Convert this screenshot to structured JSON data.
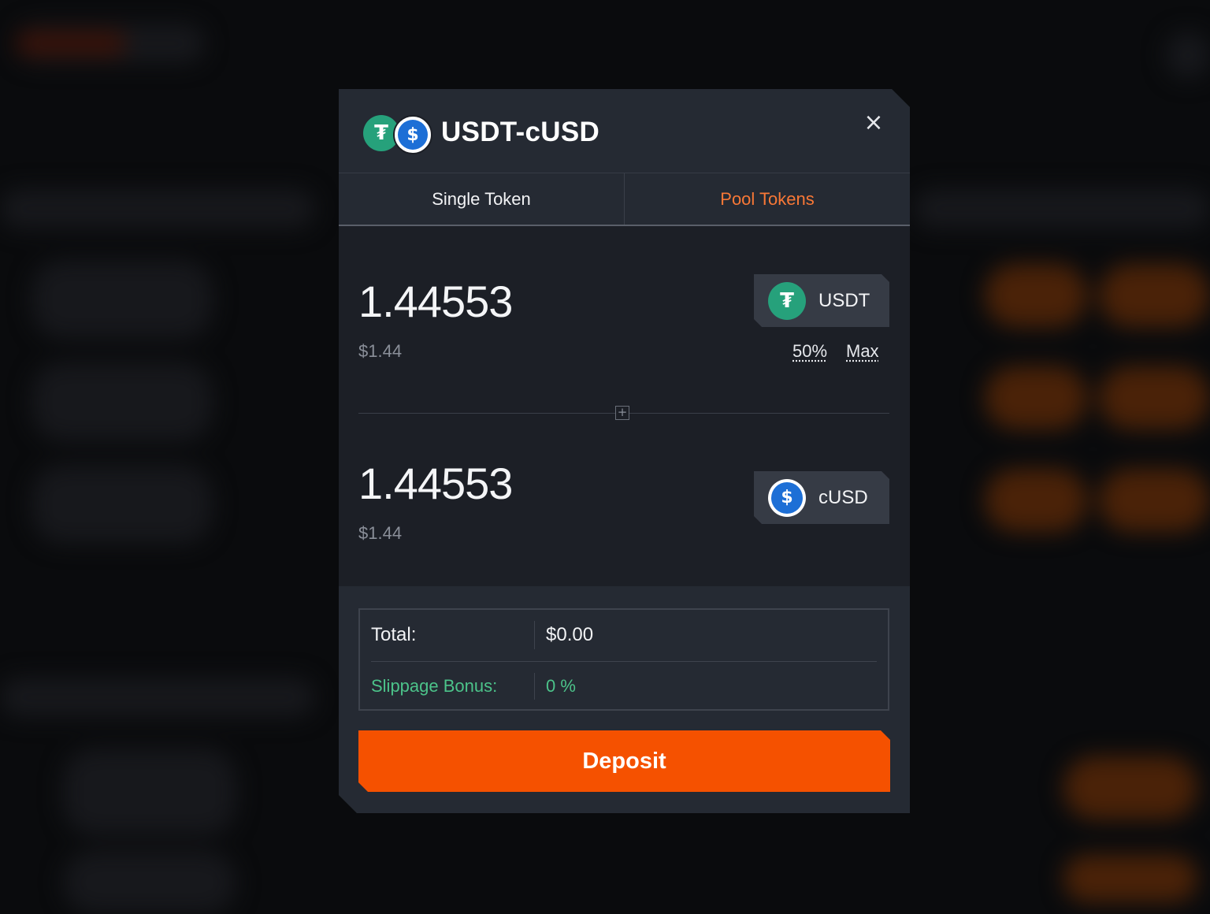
{
  "modal": {
    "title": "USDT-cUSD",
    "close_label": "×",
    "pair_icons": [
      "tether-icon",
      "cusd-icon"
    ]
  },
  "tabs": [
    {
      "label": "Single Token",
      "active": false
    },
    {
      "label": "Pool Tokens",
      "active": true
    }
  ],
  "inputs": [
    {
      "amount": "1.44553",
      "usd_value": "$1.44",
      "token": "USDT",
      "icon": "tether-icon"
    },
    {
      "amount": "1.44553",
      "usd_value": "$1.44",
      "token": "cUSD",
      "icon": "cusd-icon"
    }
  ],
  "quick_amounts": [
    "50%",
    "Max"
  ],
  "divider_icon": "plus-square-icon",
  "summary": {
    "total_label": "Total:",
    "total_value": "$0.00",
    "slippage_label": "Slippage Bonus:",
    "slippage_value": "0 %"
  },
  "deposit_label": "Deposit",
  "colors": {
    "accent": "#f55100",
    "active_tab": "#f97836",
    "bonus_green": "#4cc38a",
    "tether": "#26a17b",
    "cusd": "#1d6fd6"
  }
}
